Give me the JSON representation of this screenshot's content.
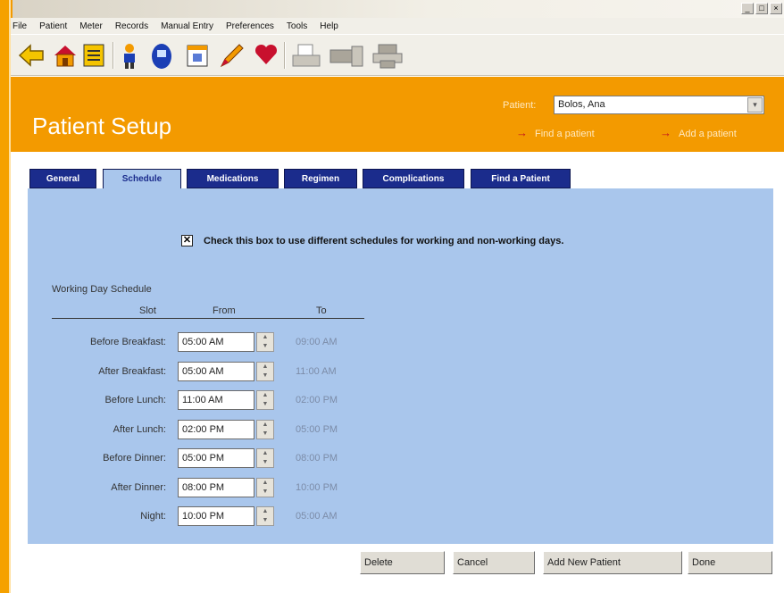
{
  "window": {
    "buttons": [
      "_",
      "□",
      "×"
    ]
  },
  "menu": [
    "File",
    "Patient",
    "Meter",
    "Records",
    "Manual Entry",
    "Preferences",
    "Tools",
    "Help"
  ],
  "toolbar_icons": [
    "back-arrow-icon",
    "home-icon",
    "list-icon",
    "person-icon",
    "meter-icon",
    "calendar-icon",
    "pencil-icon",
    "heart-icon",
    "print-preview-icon",
    "transfer-icon",
    "printer-icon"
  ],
  "header": {
    "title": "Patient Setup",
    "patient_label": "Patient:",
    "patient_value": "Bolos, Ana",
    "link_find": "Find a patient",
    "link_add": "Add a patient",
    "link_arrow": "→",
    "dropdown_glyph": "▾"
  },
  "tabs": [
    {
      "label": "General"
    },
    {
      "label": "Schedule"
    },
    {
      "label": "Medications"
    },
    {
      "label": "Regimen"
    },
    {
      "label": "Complications"
    },
    {
      "label": "Find a Patient"
    }
  ],
  "schedule": {
    "checkbox_checked": true,
    "checkbox_mark": "✕",
    "checkbox_label": "Check this box to use different schedules for working and non-working days.",
    "section_title": "Working Day Schedule",
    "col_slot": "Slot",
    "col_from": "From",
    "col_to": "To",
    "spin_up": "▲",
    "spin_down": "▼",
    "rows": [
      {
        "slot": "Before Breakfast:",
        "from": "05:00  AM",
        "to": "09:00  AM"
      },
      {
        "slot": "After Breakfast:",
        "from": "05:00  AM",
        "to": "11:00  AM"
      },
      {
        "slot": "Before Lunch:",
        "from": "11:00  AM",
        "to": "02:00  PM"
      },
      {
        "slot": "After Lunch:",
        "from": "02:00  PM",
        "to": "05:00  PM"
      },
      {
        "slot": "Before Dinner:",
        "from": "05:00  PM",
        "to": "08:00  PM"
      },
      {
        "slot": "After Dinner:",
        "from": "08:00  PM",
        "to": "10:00  PM"
      },
      {
        "slot": "Night:",
        "from": "10:00  PM",
        "to": "05:00  AM"
      }
    ]
  },
  "buttons": {
    "delete": "Delete",
    "cancel": "Cancel",
    "add_new": "Add New Patient",
    "done": "Done"
  },
  "colors": {
    "header_orange": "#f39a00",
    "tab_navy": "#1b2c8c",
    "panel_blue": "#a9c6ec"
  }
}
